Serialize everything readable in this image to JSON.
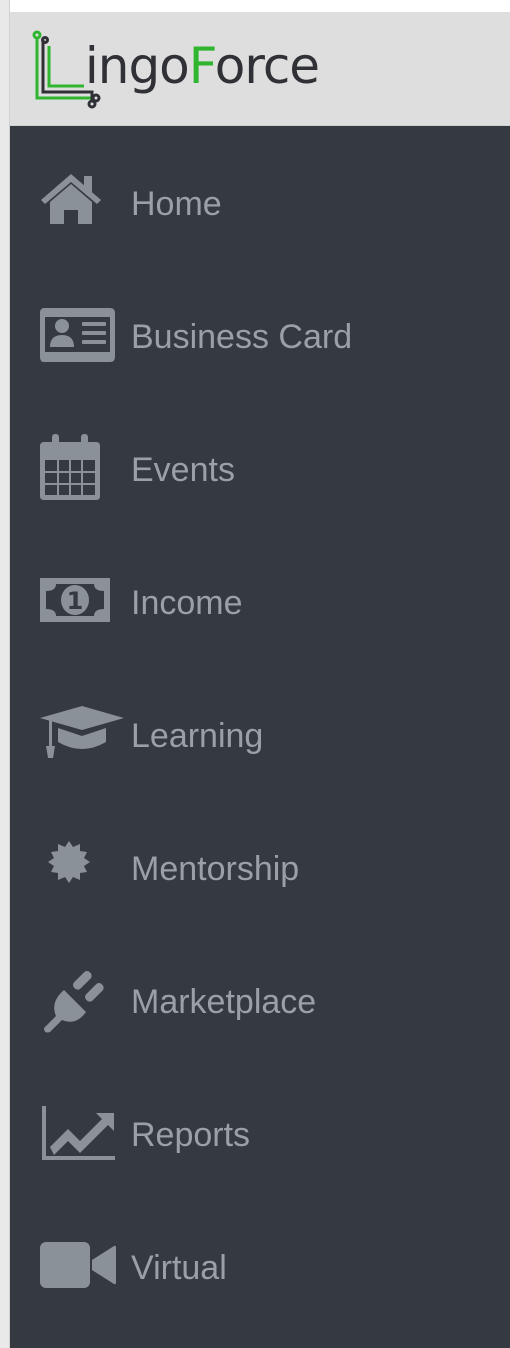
{
  "brand": {
    "logo_part1": "L",
    "logo_part2": "ingo",
    "logo_part3": "F",
    "logo_part4": "orce",
    "accent_color": "#2fb52f",
    "text_color": "#2f3136"
  },
  "sidebar": {
    "background": "#353940",
    "label_color": "#9aa0a8",
    "items": [
      {
        "label": "Home",
        "icon": "home-icon"
      },
      {
        "label": "Business Card",
        "icon": "id-card-icon"
      },
      {
        "label": "Events",
        "icon": "calendar-icon"
      },
      {
        "label": "Income",
        "icon": "money-bill-icon"
      },
      {
        "label": "Learning",
        "icon": "graduation-cap-icon"
      },
      {
        "label": "Mentorship",
        "icon": "certificate-icon"
      },
      {
        "label": "Marketplace",
        "icon": "plug-icon"
      },
      {
        "label": "Reports",
        "icon": "chart-line-icon"
      },
      {
        "label": "Virtual",
        "icon": "video-icon"
      }
    ]
  }
}
